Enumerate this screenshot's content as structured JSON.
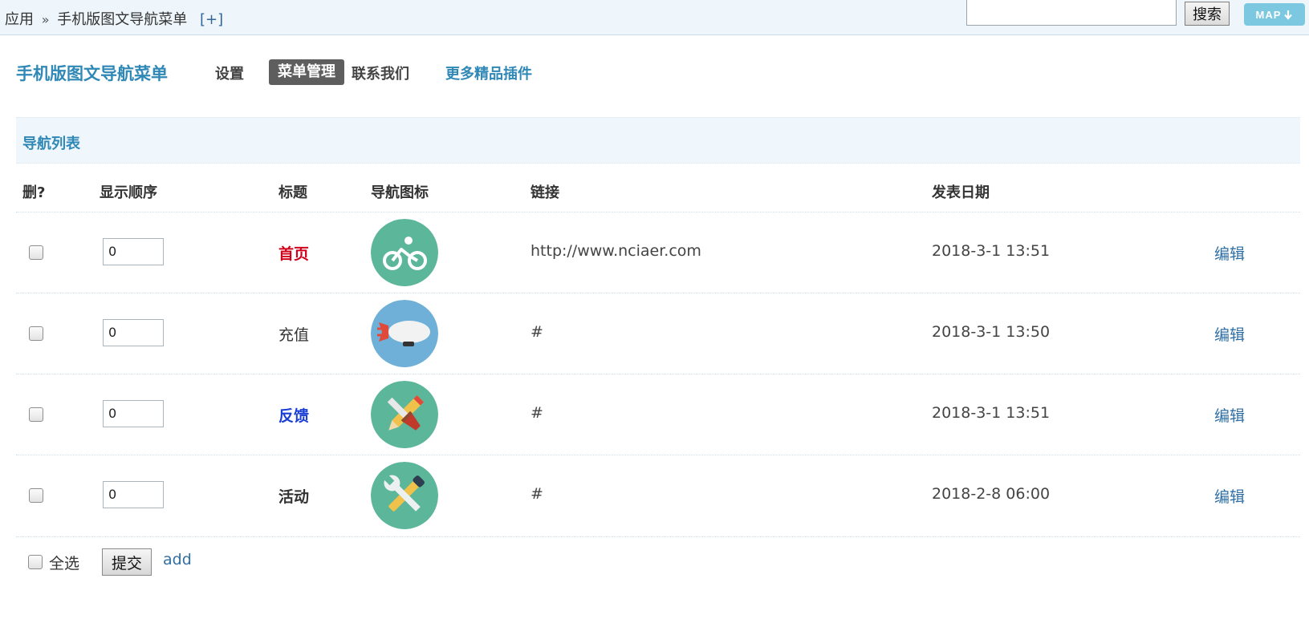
{
  "topbar": {
    "breadcrumb_root": "应用",
    "breadcrumb_sep": "»",
    "breadcrumb_page": "手机版图文导航菜单",
    "add_label": "[+]",
    "search_placeholder": "",
    "search_button": "搜索",
    "map_button": "MAP",
    "map_icon": "down-arrow-icon"
  },
  "subnav": {
    "plugin_title": "手机版图文导航菜单",
    "items": [
      {
        "label": "设置",
        "active": false
      },
      {
        "label": "菜单管理",
        "active": true
      },
      {
        "label": "联系我们",
        "active": false
      },
      {
        "label": "更多精品插件",
        "active": false,
        "color": "#2f88b6"
      }
    ]
  },
  "section": {
    "title": "导航列表"
  },
  "table": {
    "headers": [
      "删?",
      "显示顺序",
      "标题",
      "导航图标",
      "链接",
      "发表日期"
    ],
    "rows": [
      {
        "order": "0",
        "title": "首页",
        "title_color": "#d0021b",
        "title_bold": true,
        "icon": "bicycle-icon",
        "icon_bg": "#5bb69a",
        "link": "http://www.nciaer.com",
        "date": "2018-3-1 13:51",
        "action": "编辑"
      },
      {
        "order": "0",
        "title": "充值",
        "title_color": "#333333",
        "title_bold": false,
        "icon": "blimp-icon",
        "icon_bg": "#6fb0d9",
        "link": "#",
        "date": "2018-3-1 13:50",
        "action": "编辑"
      },
      {
        "order": "0",
        "title": "反馈",
        "title_color": "#1a3fd6",
        "title_bold": true,
        "icon": "pencil-brush-icon",
        "icon_bg": "#5bb69a",
        "link": "#",
        "date": "2018-3-1 13:51",
        "action": "编辑"
      },
      {
        "order": "0",
        "title": "活动",
        "title_color": "#333333",
        "title_bold": true,
        "icon": "wrench-screwdriver-icon",
        "icon_bg": "#5bb69a",
        "link": "#",
        "date": "2018-2-8 06:00",
        "action": "编辑"
      }
    ]
  },
  "footer": {
    "select_all": "全选",
    "submit": "提交",
    "add": "add"
  }
}
